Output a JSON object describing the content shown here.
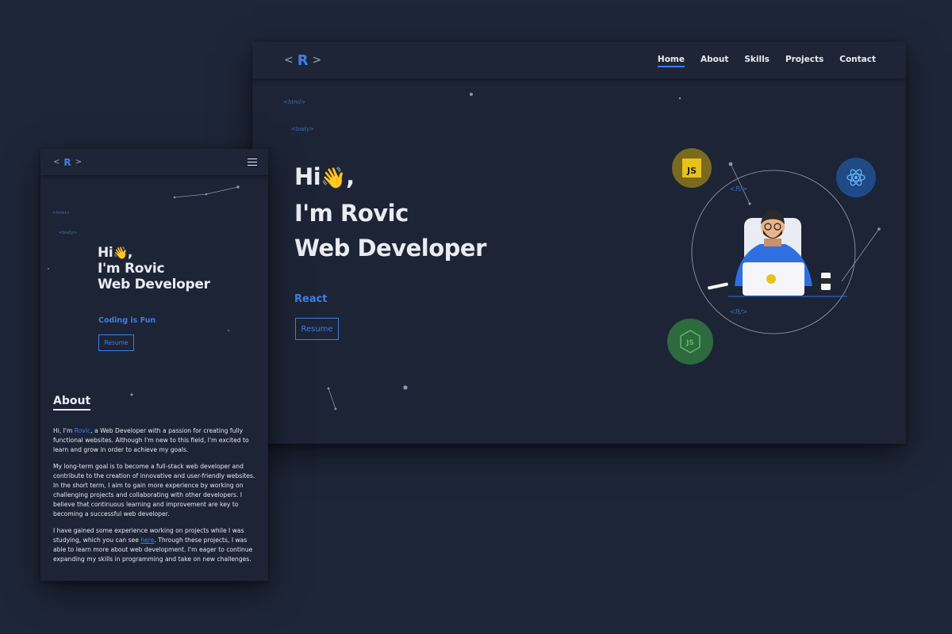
{
  "desktop": {
    "logo": {
      "left_bracket": "<",
      "letter": "R",
      "right_bracket": ">"
    },
    "nav": [
      {
        "label": "Home",
        "active": true
      },
      {
        "label": "About",
        "active": false
      },
      {
        "label": "Skills",
        "active": false
      },
      {
        "label": "Projects",
        "active": false
      },
      {
        "label": "Contact",
        "active": false
      }
    ],
    "tags": {
      "html": "<html>",
      "body": "<body>"
    },
    "hero": {
      "line1": "Hi",
      "emoji": "👋",
      "comma": ",",
      "line2": "I'm Rovic",
      "line3": "Web Developer"
    },
    "typed_text": "React",
    "resume_label": "Resume",
    "illustration": {
      "badges": [
        {
          "name": "JS",
          "color": "#7a6a1e",
          "label": "JS"
        },
        {
          "name": "React",
          "color": "#1f4a86"
        },
        {
          "name": "NodeJS",
          "color": "#2d6a3e",
          "label": "JS"
        }
      ],
      "code_tags": [
        "<R/>",
        "<R/>"
      ]
    }
  },
  "mobile": {
    "logo": {
      "left_bracket": "<",
      "letter": "R",
      "right_bracket": ">"
    },
    "tags": {
      "html": "<html>",
      "body": "<body>"
    },
    "hero": {
      "line1": "Hi",
      "emoji": "👋",
      "comma": ",",
      "line2": "I'm Rovic",
      "line3": "Web Developer"
    },
    "typed_text": "Coding is Fun",
    "resume_label": "Resume",
    "about": {
      "title": "About",
      "p1_pre": "Hi, I'm ",
      "p1_name": "Rovic",
      "p1_post": ", a Web Developer with a passion for creating fully functional websites. Although I'm new to this field, I'm excited to learn and grow in order to achieve my goals.",
      "p2": "My long-term goal is to become a full-stack web developer and contribute to the creation of innovative and user-friendly websites. In the short term, I aim to gain more experience by working on challenging projects and collaborating with other developers. I believe that continuous learning and improvement are key to becoming a successful web developer.",
      "p3_pre": "I have gained some experience working on projects while I was studying, which you can see ",
      "p3_link": "here",
      "p3_post": ". Through these projects, I was able to learn more about web development. I'm eager to continue expanding my skills in programming and take on new challenges."
    }
  },
  "colors": {
    "background": "#1e2739",
    "surface": "#1c2436",
    "accent": "#3f7ee8",
    "text": "#e9ecf2"
  }
}
